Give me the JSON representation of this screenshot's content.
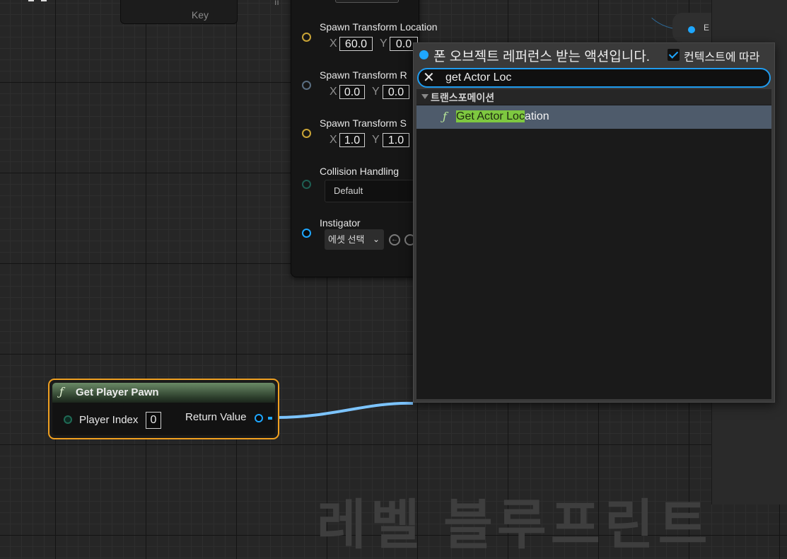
{
  "top_node": {
    "key_label": "Key"
  },
  "spawn_node": {
    "location_label": "Spawn Transform Location",
    "location_x": "60.0",
    "location_y": "0.0",
    "rotation_label": "Spawn Transform R",
    "rotation_x": "0.0",
    "rotation_y": "0.0",
    "scale_label": "Spawn Transform S",
    "scale_x": "1.0",
    "scale_y": "1.0",
    "axis_x": "X",
    "axis_y": "Y",
    "collision_label": "Collision Handling",
    "collision_value": "Default",
    "instigator_label": "Instigator",
    "asset_select_label": "에셋 선택"
  },
  "right_node": {
    "label": "E"
  },
  "get_player_pawn": {
    "icon": "function-icon",
    "title": "Get Player Pawn",
    "input_label": "Player Index",
    "input_value": "0",
    "output_label": "Return Value"
  },
  "context_menu": {
    "context_text": "폰 오브젝트 레퍼런스 받는 액션입니다.",
    "checkbox_label": "컨텍스트에 따라",
    "checkbox_checked": true,
    "search_value": "get Actor Loc",
    "category": "트랜스포메이션",
    "items": [
      {
        "icon": "function-icon",
        "highlight": "Get Actor Loc",
        "rest": "ation"
      }
    ]
  },
  "background_text": "레벨 블루프린트",
  "colors": {
    "accent_blue": "#1ea7ff",
    "selection_orange": "#f0a020",
    "match_highlight": "#7ec840",
    "selected_row": "#4e5b6b"
  }
}
